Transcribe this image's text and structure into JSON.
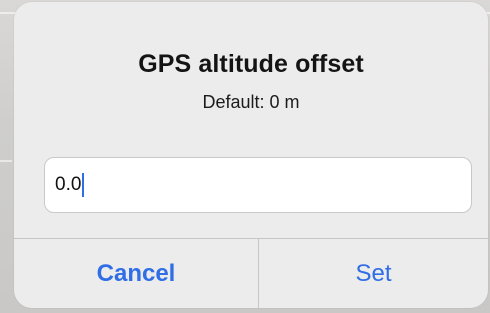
{
  "dialog": {
    "title": "GPS altitude offset",
    "message": "Default: 0 m",
    "input": {
      "value": "0.0"
    },
    "buttons": {
      "cancel_label": "Cancel",
      "set_label": "Set"
    }
  },
  "colors": {
    "accent": "#2f6ee6",
    "dialog_background": "#ececec",
    "divider": "#c6c6c6"
  }
}
